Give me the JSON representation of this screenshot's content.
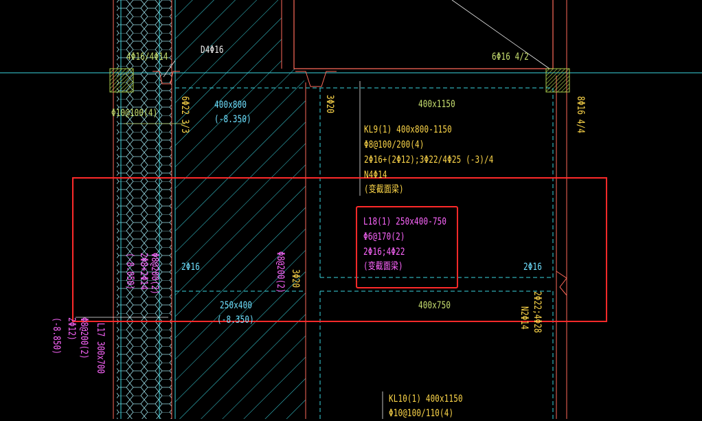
{
  "colors": {
    "background": "#000000",
    "beam_outline": "#ff6a5a",
    "dashed_lines": "#3ad6e0",
    "hatch": "#3ad6e0",
    "hex_fill": "#9adfe8",
    "highlight_box": "#ff2a2a",
    "label_yellow": "#ffd84a",
    "label_green": "#c8e070",
    "label_magenta": "#ff66ff",
    "column_fill": "#a8c84a"
  },
  "labels": {
    "top_left_rebar": "4Φ16/4Φ14",
    "d4": "D4Φ16",
    "stirrup_left": "Φ10@100(4)",
    "top_right_rebar": "6Φ16 4/2",
    "right_vertical": "8Φ16 4/4",
    "beam_400x800": "400x800",
    "beam_400x800_elev": "(-8.350)",
    "beam_400x1150_top": "400x1150",
    "vert_6_22": "6Φ22 3/3",
    "vert_3_20_top": "3Φ20",
    "kl9_title": "KL9(1) 400x800-1150",
    "kl9_stirrup": "Φ8@100/200(4)",
    "kl9_rebar": "2Φ16+(2Φ12);3Φ22/4Φ25 (-3)/4",
    "kl9_n": "N4Φ14",
    "kl9_note": "(变截面梁)",
    "l18_title": "L18(1) 250x400-750",
    "l18_stirrup": "Φ6@170(2)",
    "l18_rebar": "2Φ16;4Φ22",
    "l18_note": "(变截面梁)",
    "left_2_16": "2Φ16",
    "right_2_16": "2Φ16",
    "vert_mid_1": "Φ8@200(2)",
    "vert_mid_2": "3Φ20",
    "vert_left_1": "(-8.050)",
    "vert_left_2": "2Φ8+2Φ14",
    "vert_left_3": "Φ8@200(2)",
    "beam_250x400": "250x400",
    "beam_250x400_elev": "(-8.350)",
    "beam_400x750": "400x750",
    "vert_right_1": "2Φ22;4Φ28",
    "vert_right_2": "N2Φ14",
    "bottom_left_1": "(-8.850)",
    "bottom_left_2": "2Φ12)",
    "bottom_left_3": "Φ8@200(2)",
    "bottom_left_4": "L17 300x700",
    "kl10_title": "KL10(1) 400x1150",
    "kl10_stirrup": "Φ10@100/110(4)"
  }
}
